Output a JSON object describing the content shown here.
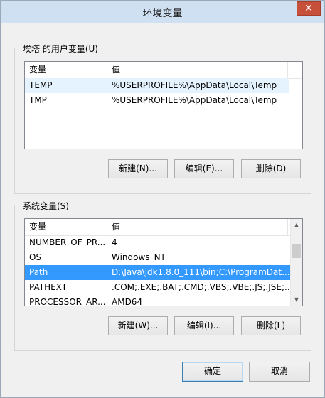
{
  "window": {
    "title": "环境变量",
    "close_label": "✕"
  },
  "user_vars": {
    "legend": "埃塔 的用户变量(U)",
    "columns": [
      "变量",
      "值"
    ],
    "rows": [
      {
        "name": "TEMP",
        "value": "%USERPROFILE%\\AppData\\Local\\Temp"
      },
      {
        "name": "TMP",
        "value": "%USERPROFILE%\\AppData\\Local\\Temp"
      }
    ],
    "buttons": {
      "new": "新建(N)...",
      "edit": "编辑(E)...",
      "delete": "删除(D)"
    }
  },
  "system_vars": {
    "legend": "系统变量(S)",
    "columns": [
      "变量",
      "值"
    ],
    "rows": [
      {
        "name": "NUMBER_OF_PR...",
        "value": "4"
      },
      {
        "name": "OS",
        "value": "Windows_NT"
      },
      {
        "name": "Path",
        "value": "D:\\Java\\jdk1.8.0_111\\bin;C:\\ProgramDat..."
      },
      {
        "name": "PATHEXT",
        "value": ".COM;.EXE;.BAT;.CMD;.VBS;.VBE;.JS;.JSE;..."
      },
      {
        "name": "PROCESSOR_AR...",
        "value": "AMD64"
      }
    ],
    "selected_row": "Path",
    "buttons": {
      "new": "新建(W)...",
      "edit": "编辑(I)...",
      "delete": "删除(L)"
    }
  },
  "dialog_buttons": {
    "ok": "确定",
    "cancel": "取消"
  },
  "colors": {
    "selection": "#3399ff",
    "hover": "#e5f3ff",
    "close": "#c7503a"
  }
}
